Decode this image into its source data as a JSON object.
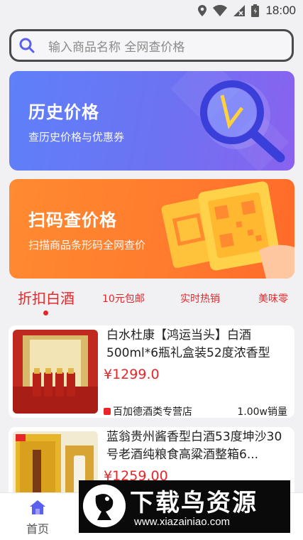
{
  "status_bar": {
    "time": "18:00"
  },
  "search": {
    "placeholder": "输入商品名称 全网查价格"
  },
  "banners": [
    {
      "title": "历史价格",
      "subtitle": "查历史价格与优惠券",
      "color": "#6d72f2"
    },
    {
      "title": "扫码查价格",
      "subtitle": "扫描商品条形码全网查价",
      "color": "#ff7a2e"
    }
  ],
  "tabs": [
    {
      "label": "折扣白酒",
      "active": true
    },
    {
      "label": "10元包邮"
    },
    {
      "label": "实时热销"
    },
    {
      "label": "美味零"
    }
  ],
  "products": [
    {
      "title": "白水杜康【鸿运当头】白酒500ml*6瓶礼盒装52度浓香型",
      "price": "¥1299.0",
      "shop": "百加德酒类专营店",
      "sales": "1.00w销量"
    },
    {
      "title": "蓝翁贵州酱香型白酒53度坤沙30号老酒纯粮食高粱酒整箱6...",
      "price": "¥1259.00"
    }
  ],
  "bottom_nav": {
    "home_label": "首页"
  },
  "watermark": {
    "title": "下载鸟资源",
    "url": "www.xiazainiao.com"
  },
  "colors": {
    "accent": "#e8262a",
    "nav_active": "#5b5ff0"
  }
}
